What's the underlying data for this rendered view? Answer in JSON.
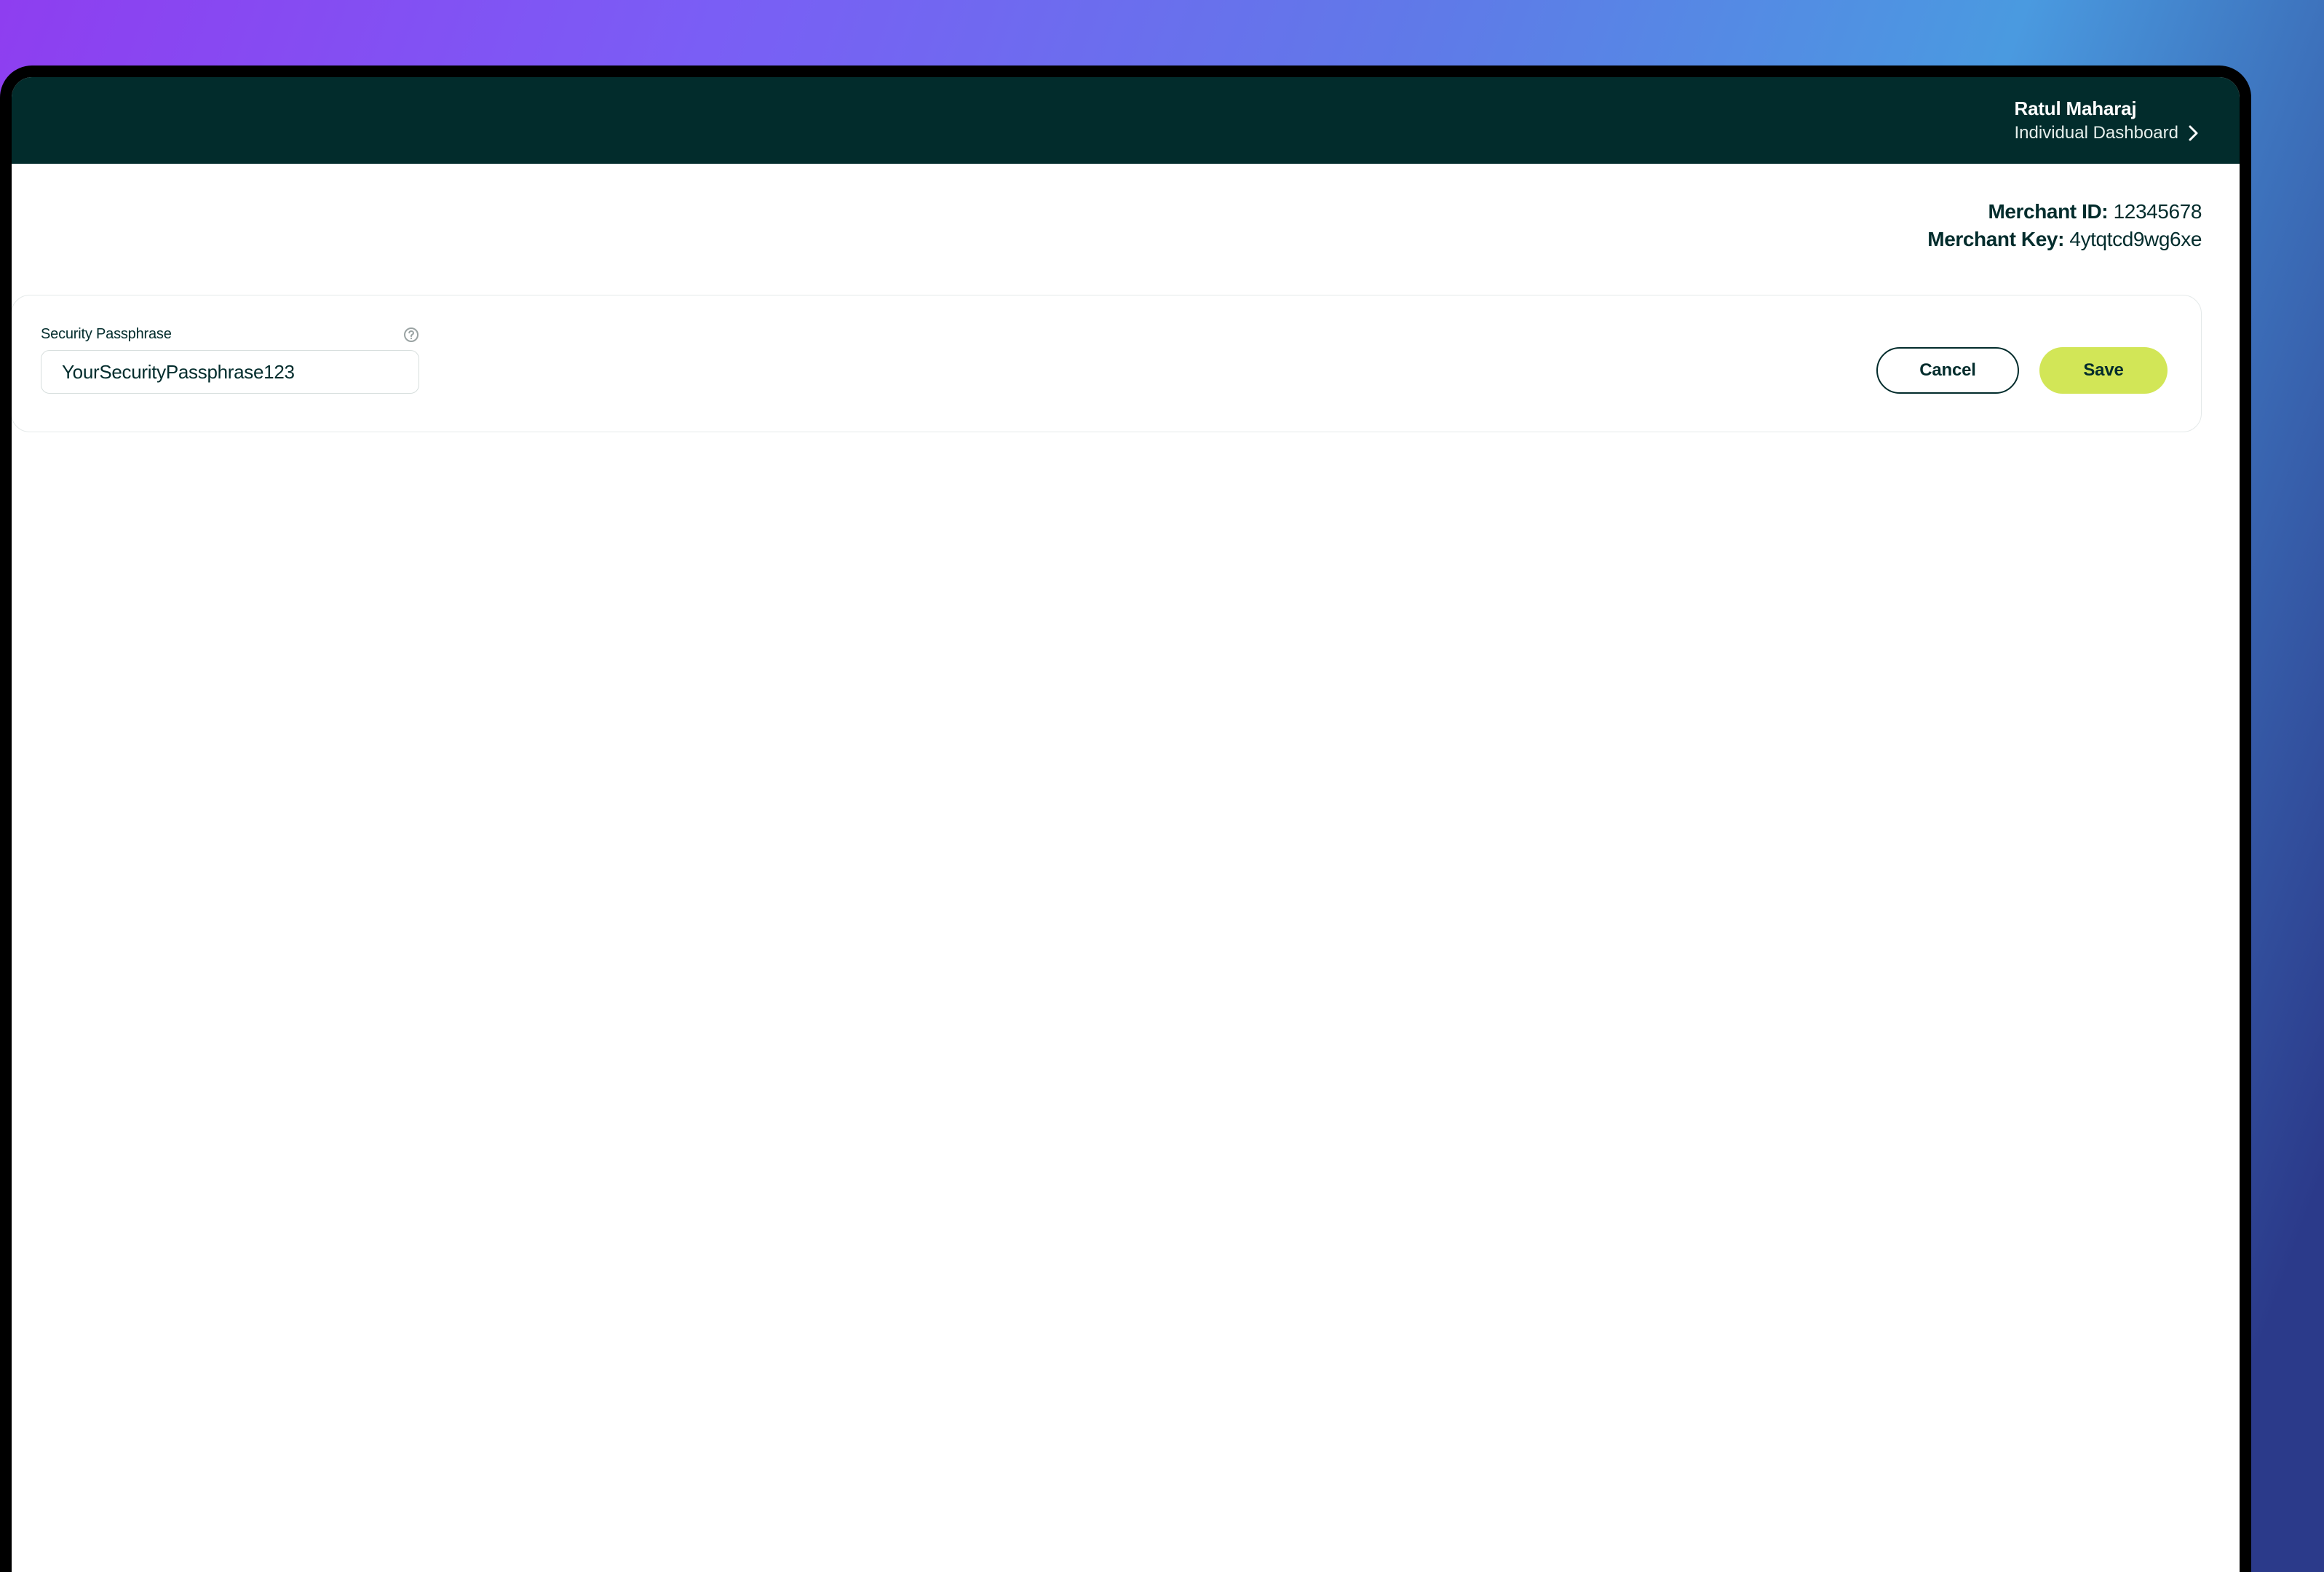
{
  "header": {
    "user_name": "Ratul Maharaj",
    "dashboard_label": "Individual Dashboard"
  },
  "merchant": {
    "id_label": "Merchant ID:",
    "id_value": "12345678",
    "key_label": "Merchant Key:",
    "key_value": "4ytqtcd9wg6xe"
  },
  "form": {
    "passphrase_label": "Security Passphrase",
    "passphrase_value": "YourSecurityPassphrase123",
    "cancel_label": "Cancel",
    "save_label": "Save"
  },
  "icons": {
    "chevron_right": "chevron-right-icon",
    "help": "help-icon"
  },
  "colors": {
    "header_bg": "#022c2c",
    "primary_btn": "#d2e657",
    "text_dark": "#022c2c"
  }
}
